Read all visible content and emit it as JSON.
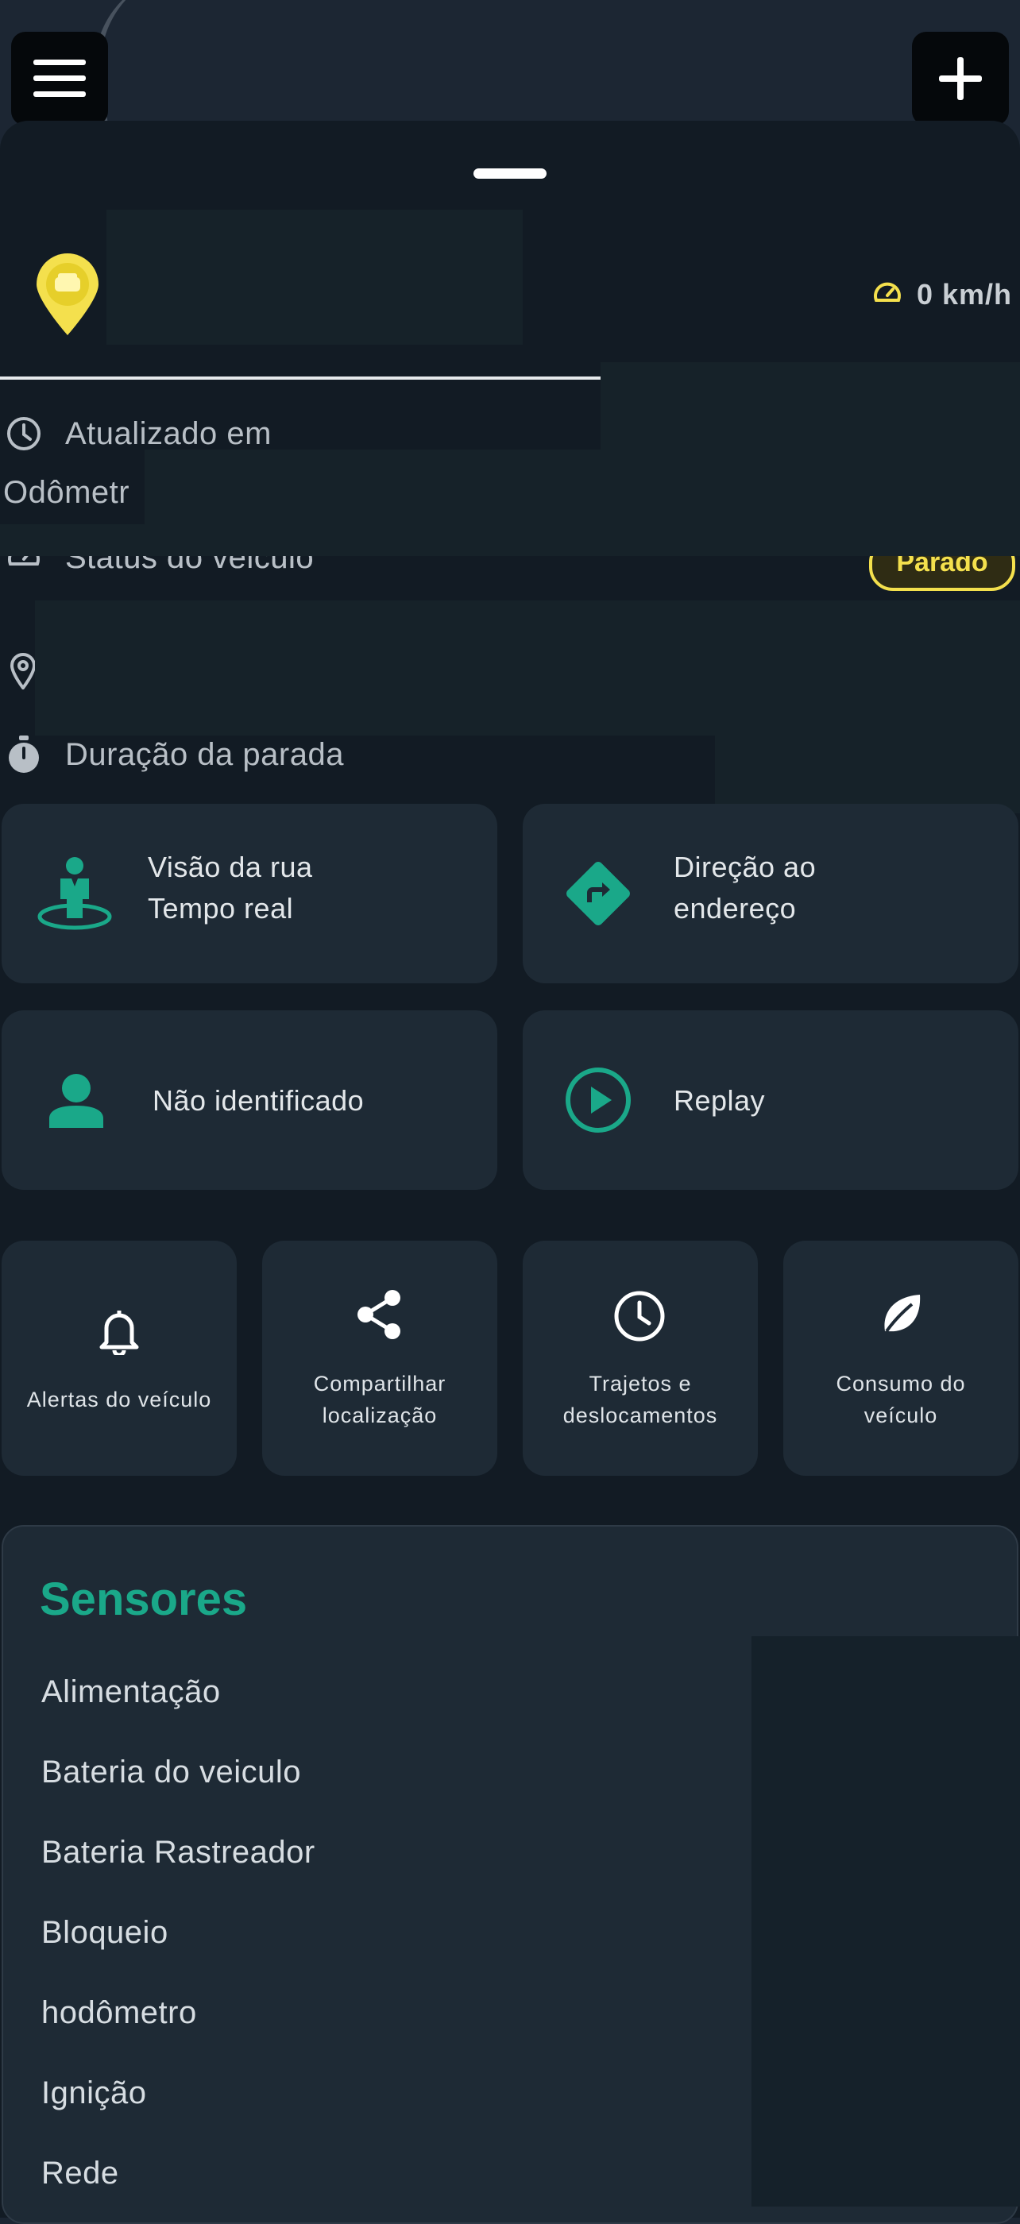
{
  "header": {
    "menu_icon": "hamburger-menu-icon",
    "add_icon": "plus-icon"
  },
  "vehicle": {
    "marker_icon": "car-pin-icon",
    "speed": "0 km/h",
    "speed_icon": "speedometer-icon",
    "status_badge": "Parado"
  },
  "info": {
    "updated_label": "Atualizado em",
    "odometer_label": "Odômetr",
    "status_label": "Status do veiculo",
    "stop_duration_label": "Duração da parada"
  },
  "actions": {
    "street_view": {
      "line1": "Visão da rua",
      "line2": "Tempo real"
    },
    "directions": {
      "line1": "Direção ao",
      "line2": "endereço"
    },
    "driver": {
      "label": "Não identificado"
    },
    "replay": {
      "label": "Replay"
    }
  },
  "shortcuts": {
    "alerts": {
      "line1": "Alertas do veículo"
    },
    "share": {
      "line1": "Compartilhar",
      "line2": "localização"
    },
    "trips": {
      "line1": "Trajetos e",
      "line2": "deslocamentos"
    },
    "consumption": {
      "line1": "Consumo do",
      "line2": "veículo"
    }
  },
  "sensors": {
    "title": "Sensores",
    "items": [
      "Alimentação",
      "Bateria do veiculo",
      "Bateria Rastreador",
      "Bloqueio",
      "hodômetro",
      "Ignição",
      "Rede"
    ]
  },
  "colors": {
    "accent": "#1aa889",
    "warning": "#f4e04d",
    "background": "#121b24",
    "card": "#1e2a35"
  }
}
